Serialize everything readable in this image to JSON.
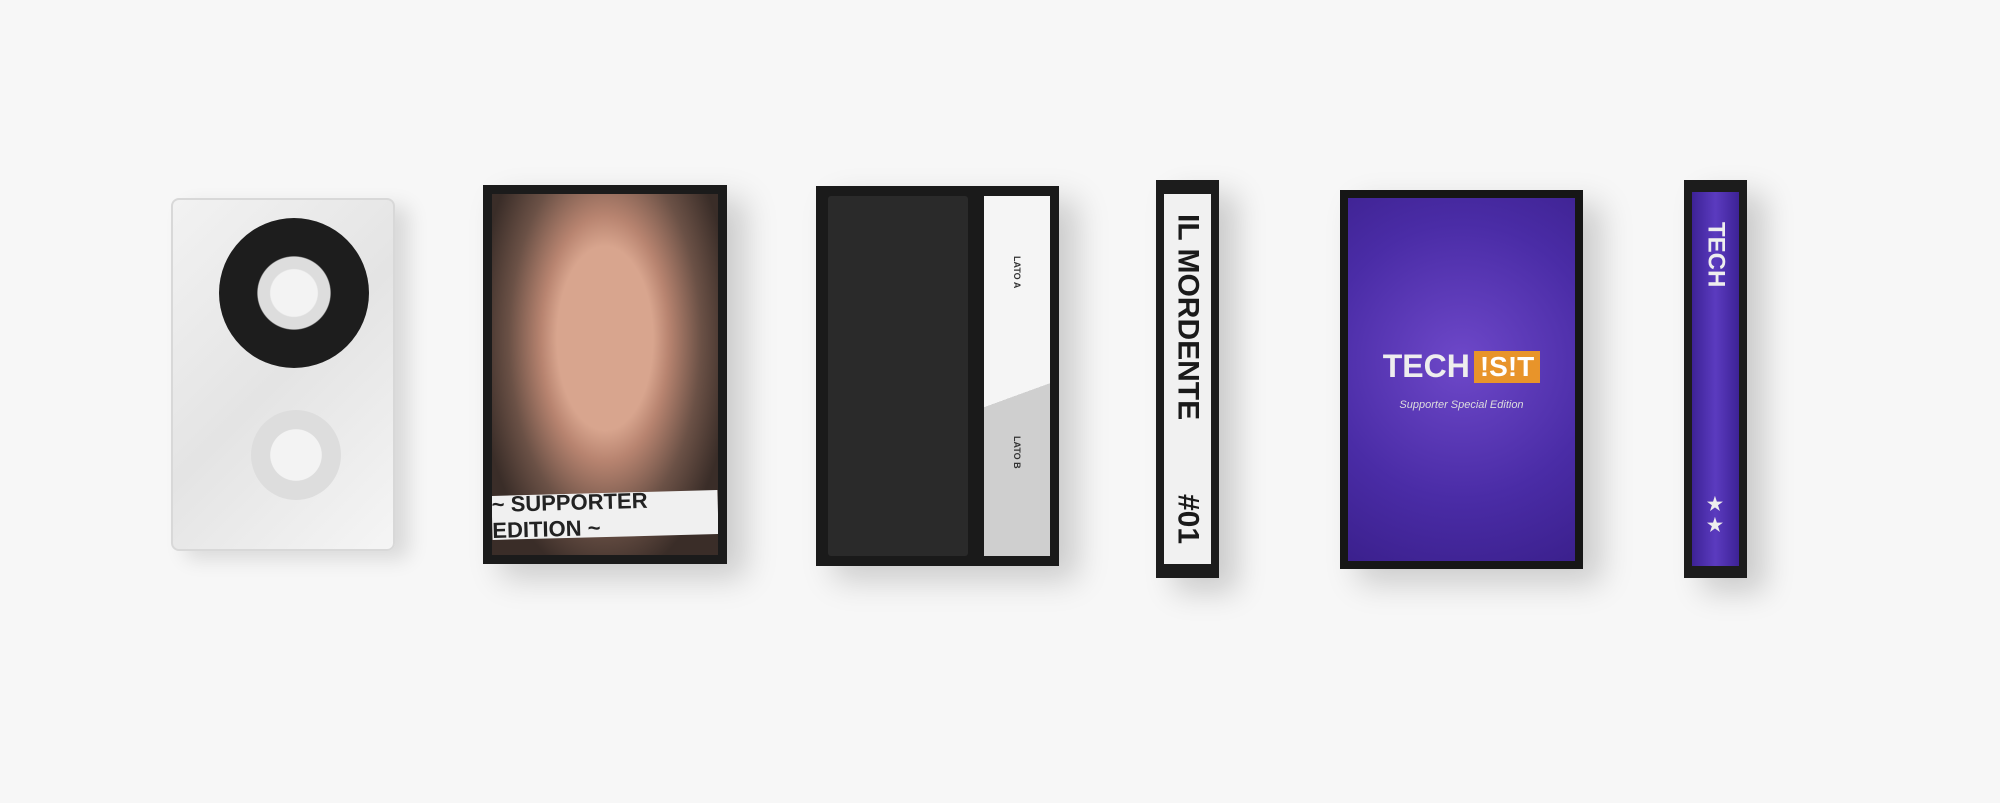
{
  "supporter_cover": {
    "banner": "~ SUPPORTER EDITION ~"
  },
  "jcard": {
    "side_a": "LATO A",
    "side_b": "LATO B"
  },
  "spine1": {
    "title": "IL MORDENTE",
    "number": "#01"
  },
  "tech_cover": {
    "logo_main": "TECH",
    "logo_accent": "!S!T",
    "subtitle": "Supporter Special Edition",
    "accent_color": "#e8942a",
    "cover_color": "#4a2ca6"
  },
  "spine2": {
    "title": "TECH",
    "stars": "★★"
  }
}
